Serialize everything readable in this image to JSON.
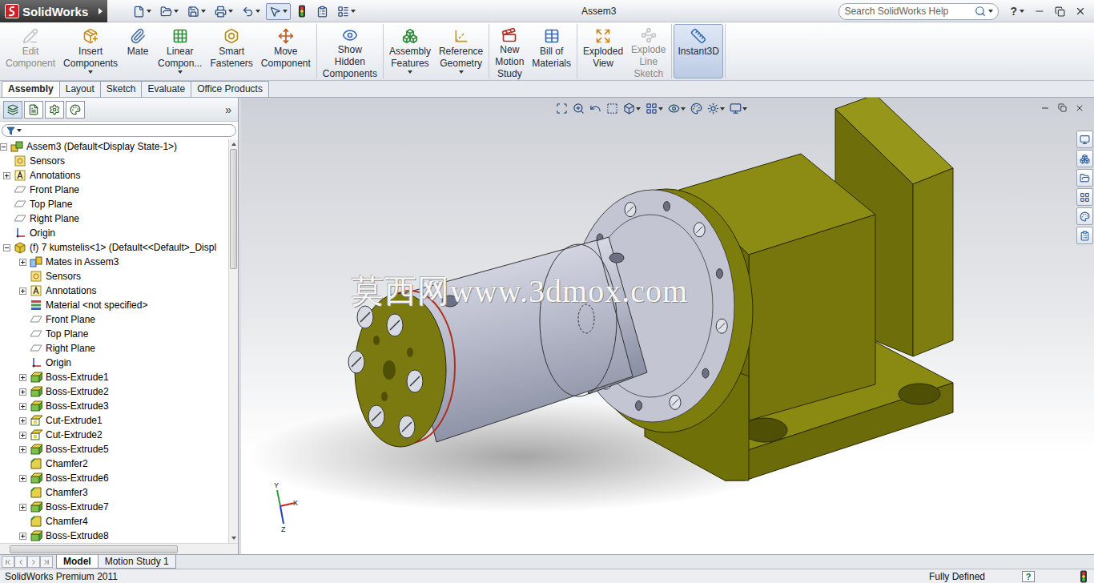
{
  "window": {
    "title": "Assem3"
  },
  "logo": {
    "text": "SolidWorks"
  },
  "quick_access": [
    {
      "dropdown": true,
      "selected": false
    },
    {
      "dropdown": true,
      "selected": false
    },
    {
      "dropdown": true,
      "selected": false
    },
    {
      "dropdown": true,
      "selected": false
    },
    {
      "dropdown": true,
      "selected": false
    },
    {
      "dropdown": true,
      "selected": true
    },
    {
      "dropdown": false,
      "selected": false
    },
    {
      "dropdown": false,
      "selected": false
    },
    {
      "dropdown": true,
      "selected": false
    }
  ],
  "search": {
    "placeholder": "Search SolidWorks Help"
  },
  "help": {
    "label": "?"
  },
  "ribbon": {
    "groups": [
      {
        "buttons": [
          {
            "lines": [
              "Edit",
              "Component"
            ],
            "dropdown": false,
            "disabled": true,
            "selected": false
          },
          {
            "lines": [
              "Insert",
              "Components"
            ],
            "dropdown": true,
            "disabled": false,
            "selected": false
          },
          {
            "lines": [
              "Mate"
            ],
            "dropdown": false,
            "disabled": false,
            "selected": false
          },
          {
            "lines": [
              "Linear",
              "Compon..."
            ],
            "dropdown": true,
            "disabled": false,
            "selected": false
          },
          {
            "lines": [
              "Smart",
              "Fasteners"
            ],
            "dropdown": false,
            "disabled": false,
            "selected": false
          },
          {
            "lines": [
              "Move",
              "Component"
            ],
            "dropdown": false,
            "disabled": false,
            "selected": false
          }
        ]
      },
      {
        "buttons": [
          {
            "lines": [
              "Show",
              "Hidden",
              "Components"
            ],
            "dropdown": false,
            "disabled": false,
            "selected": false
          }
        ]
      },
      {
        "buttons": [
          {
            "lines": [
              "Assembly",
              "Features"
            ],
            "dropdown": true,
            "disabled": false,
            "selected": false
          },
          {
            "lines": [
              "Reference",
              "Geometry"
            ],
            "dropdown": true,
            "disabled": false,
            "selected": false
          }
        ]
      },
      {
        "buttons": [
          {
            "lines": [
              "New",
              "Motion",
              "Study"
            ],
            "dropdown": false,
            "disabled": false,
            "selected": false
          },
          {
            "lines": [
              "Bill of",
              "Materials"
            ],
            "dropdown": false,
            "disabled": false,
            "selected": false
          }
        ]
      },
      {
        "buttons": [
          {
            "lines": [
              "Exploded",
              "View"
            ],
            "dropdown": false,
            "disabled": false,
            "selected": false
          },
          {
            "lines": [
              "Explode",
              "Line",
              "Sketch"
            ],
            "dropdown": false,
            "disabled": true,
            "selected": false
          }
        ]
      },
      {
        "buttons": [
          {
            "lines": [
              "Instant3D"
            ],
            "dropdown": false,
            "disabled": false,
            "selected": true
          }
        ]
      }
    ]
  },
  "tabs": [
    {
      "label": "Assembly",
      "selected": true
    },
    {
      "label": "Layout",
      "selected": false
    },
    {
      "label": "Sketch",
      "selected": false
    },
    {
      "label": "Evaluate",
      "selected": false
    },
    {
      "label": "Office Products",
      "selected": false
    }
  ],
  "panel": {
    "tabs": [
      {
        "selected": true
      },
      {
        "selected": false
      },
      {
        "selected": false
      },
      {
        "selected": false
      }
    ],
    "more": "»"
  },
  "tree": [
    {
      "label": "Assem3 (Default<Display State-1>)",
      "level": 0,
      "kind": "assembly",
      "expandable": true,
      "expanded": true
    },
    {
      "label": "Sensors",
      "level": 1,
      "kind": "sensors",
      "expandable": false,
      "expanded": false
    },
    {
      "label": "Annotations",
      "level": 1,
      "kind": "annotations",
      "expandable": true,
      "expanded": false
    },
    {
      "label": "Front Plane",
      "level": 1,
      "kind": "plane",
      "expandable": false,
      "expanded": false
    },
    {
      "label": "Top Plane",
      "level": 1,
      "kind": "plane",
      "expandable": false,
      "expanded": false
    },
    {
      "label": "Right Plane",
      "level": 1,
      "kind": "plane",
      "expandable": false,
      "expanded": false
    },
    {
      "label": "Origin",
      "level": 1,
      "kind": "origin",
      "expandable": false,
      "expanded": false
    },
    {
      "label": "(f) 7 kumstelis<1> (Default<<Default>_Displ",
      "level": 1,
      "kind": "part",
      "expandable": true,
      "expanded": true
    },
    {
      "label": "Mates in Assem3",
      "level": 2,
      "kind": "mates",
      "expandable": true,
      "expanded": false
    },
    {
      "label": "Sensors",
      "level": 2,
      "kind": "sensors",
      "expandable": false,
      "expanded": false
    },
    {
      "label": "Annotations",
      "level": 2,
      "kind": "annotations",
      "expandable": true,
      "expanded": false
    },
    {
      "label": "Material <not specified>",
      "level": 2,
      "kind": "material",
      "expandable": false,
      "expanded": false
    },
    {
      "label": "Front Plane",
      "level": 2,
      "kind": "plane",
      "expandable": false,
      "expanded": false
    },
    {
      "label": "Top Plane",
      "level": 2,
      "kind": "plane",
      "expandable": false,
      "expanded": false
    },
    {
      "label": "Right Plane",
      "level": 2,
      "kind": "plane",
      "expandable": false,
      "expanded": false
    },
    {
      "label": "Origin",
      "level": 2,
      "kind": "origin",
      "expandable": false,
      "expanded": false
    },
    {
      "label": "Boss-Extrude1",
      "level": 2,
      "kind": "extrude",
      "expandable": true,
      "expanded": false
    },
    {
      "label": "Boss-Extrude2",
      "level": 2,
      "kind": "extrude",
      "expandable": true,
      "expanded": false
    },
    {
      "label": "Boss-Extrude3",
      "level": 2,
      "kind": "extrude",
      "expandable": true,
      "expanded": false
    },
    {
      "label": "Cut-Extrude1",
      "level": 2,
      "kind": "cut",
      "expandable": true,
      "expanded": false
    },
    {
      "label": "Cut-Extrude2",
      "level": 2,
      "kind": "cut",
      "expandable": true,
      "expanded": false
    },
    {
      "label": "Boss-Extrude5",
      "level": 2,
      "kind": "extrude",
      "expandable": true,
      "expanded": false
    },
    {
      "label": "Chamfer2",
      "level": 2,
      "kind": "chamfer",
      "expandable": false,
      "expanded": false
    },
    {
      "label": "Boss-Extrude6",
      "level": 2,
      "kind": "extrude",
      "expandable": true,
      "expanded": false
    },
    {
      "label": "Chamfer3",
      "level": 2,
      "kind": "chamfer",
      "expandable": false,
      "expanded": false
    },
    {
      "label": "Boss-Extrude7",
      "level": 2,
      "kind": "extrude",
      "expandable": true,
      "expanded": false
    },
    {
      "label": "Chamfer4",
      "level": 2,
      "kind": "chamfer",
      "expandable": false,
      "expanded": false
    },
    {
      "label": "Boss-Extrude8",
      "level": 2,
      "kind": "extrude",
      "expandable": true,
      "expanded": false
    }
  ],
  "viewport": {
    "watermark": "莫西网www.3dmox.com",
    "triad": {
      "x": "X",
      "y": "Y",
      "z": "Z"
    },
    "view_toolbar": [
      {
        "dropdown": false
      },
      {
        "dropdown": false
      },
      {
        "dropdown": false
      },
      {
        "dropdown": false
      },
      {
        "dropdown": true
      },
      {
        "dropdown": true
      },
      {
        "dropdown": true
      },
      {
        "dropdown": false
      },
      {
        "dropdown": true
      },
      {
        "dropdown": true
      }
    ]
  },
  "bottom_tabs": [
    {
      "label": "Model",
      "selected": true
    },
    {
      "label": "Motion Study 1",
      "selected": false
    }
  ],
  "status_bar": {
    "product": "SolidWorks Premium 2011",
    "state": "Fully Defined",
    "help": "?"
  }
}
